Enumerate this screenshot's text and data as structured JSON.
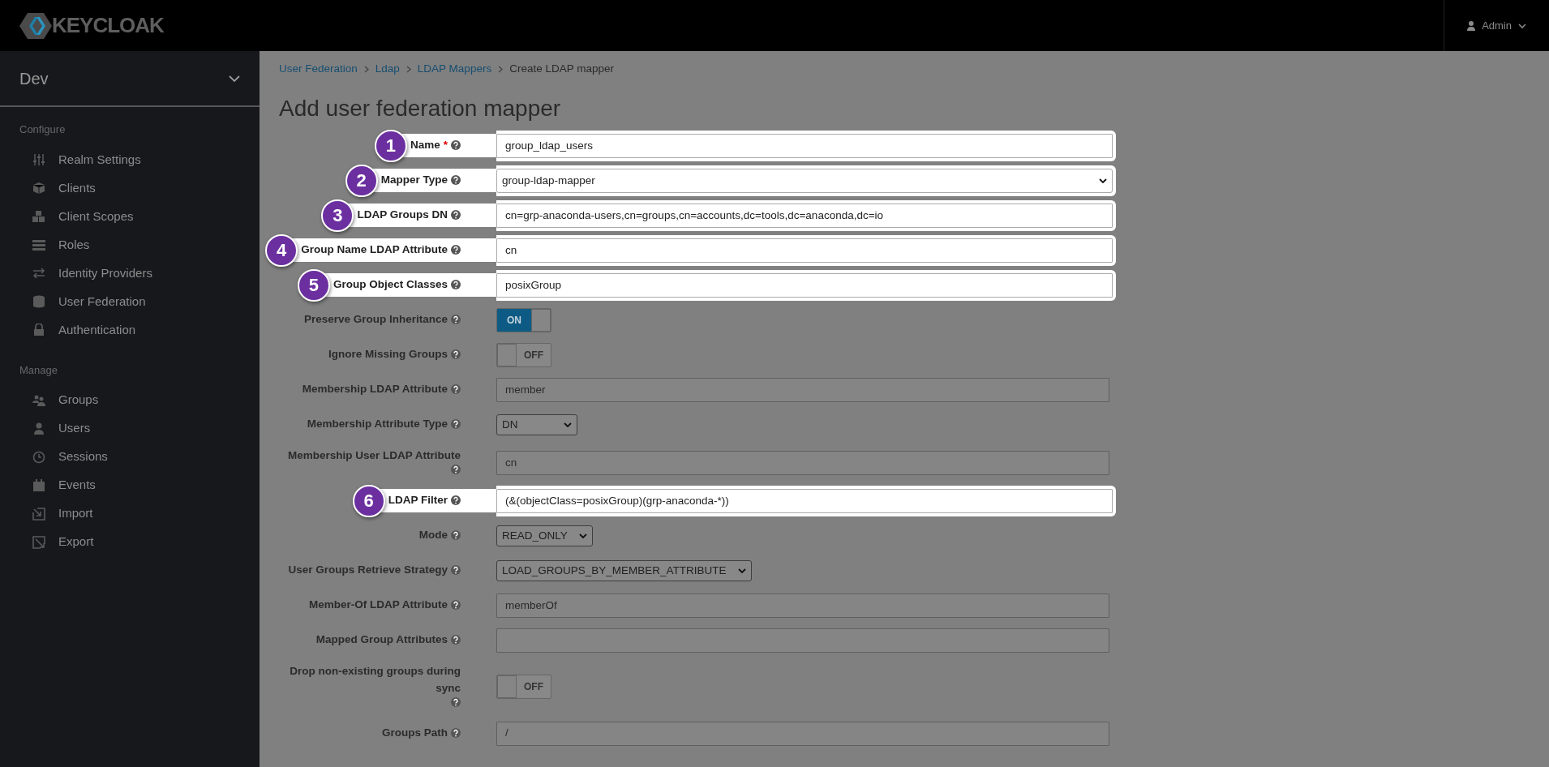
{
  "header": {
    "brand": "KEYCLOAK",
    "user": "Admin"
  },
  "sidebar": {
    "realm": "Dev",
    "sections": [
      {
        "title": "Configure",
        "items": [
          {
            "label": "Realm Settings"
          },
          {
            "label": "Clients"
          },
          {
            "label": "Client Scopes"
          },
          {
            "label": "Roles"
          },
          {
            "label": "Identity Providers"
          },
          {
            "label": "User Federation"
          },
          {
            "label": "Authentication"
          }
        ]
      },
      {
        "title": "Manage",
        "items": [
          {
            "label": "Groups"
          },
          {
            "label": "Users"
          },
          {
            "label": "Sessions"
          },
          {
            "label": "Events"
          },
          {
            "label": "Import"
          },
          {
            "label": "Export"
          }
        ]
      }
    ]
  },
  "breadcrumb": [
    {
      "label": "User Federation",
      "link": true
    },
    {
      "label": "Ldap",
      "link": true
    },
    {
      "label": "LDAP Mappers",
      "link": true
    },
    {
      "label": "Create LDAP mapper",
      "link": false
    }
  ],
  "page_title": "Add user federation mapper",
  "fields": [
    {
      "label": "Name",
      "required_mark": "*",
      "kind": "text",
      "value": "group_ldap_users",
      "highlight": "1"
    },
    {
      "label": "Mapper Type",
      "kind": "select",
      "value": "group-ldap-mapper",
      "wide": true,
      "highlight": "2"
    },
    {
      "label": "LDAP Groups DN",
      "kind": "text",
      "value": "cn=grp-anaconda-users,cn=groups,cn=accounts,dc=tools,dc=anaconda,dc=io",
      "highlight": "3"
    },
    {
      "label": "Group Name LDAP Attribute",
      "kind": "text",
      "value": "cn",
      "highlight": "4"
    },
    {
      "label": "Group Object Classes",
      "kind": "text",
      "value": "posixGroup",
      "highlight": "5"
    },
    {
      "label": "Preserve Group Inheritance",
      "kind": "toggle",
      "on": true,
      "toggle_text": "ON"
    },
    {
      "label": "Ignore Missing Groups",
      "kind": "toggle",
      "on": false,
      "toggle_text": "OFF"
    },
    {
      "label": "Membership LDAP Attribute",
      "kind": "text",
      "value": "member"
    },
    {
      "label": "Membership Attribute Type",
      "kind": "select",
      "value": "DN",
      "wide": false
    },
    {
      "label": "Membership User LDAP Attribute",
      "kind": "text",
      "value": "cn"
    },
    {
      "label": "LDAP Filter",
      "kind": "text",
      "value": "(&(objectClass=posixGroup)(grp-anaconda-*))",
      "highlight": "6"
    },
    {
      "label": "Mode",
      "kind": "select",
      "value": "READ_ONLY",
      "wide": false
    },
    {
      "label": "User Groups Retrieve Strategy",
      "kind": "select",
      "value": "LOAD_GROUPS_BY_MEMBER_ATTRIBUTE",
      "wide": false
    },
    {
      "label": "Member-Of LDAP Attribute",
      "kind": "text",
      "value": "memberOf"
    },
    {
      "label": "Mapped Group Attributes",
      "kind": "text"
    },
    {
      "label": "Drop non-existing groups during sync",
      "kind": "toggle",
      "on": false,
      "toggle_text": "OFF"
    },
    {
      "label": "Groups Path",
      "kind": "text",
      "value": "/"
    }
  ]
}
